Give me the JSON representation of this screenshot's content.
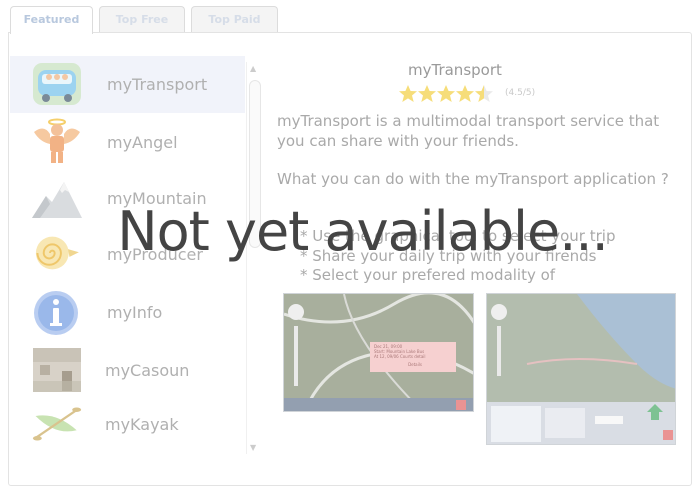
{
  "tabs": [
    {
      "label": "Featured",
      "active": true
    },
    {
      "label": "Top Free",
      "active": false
    },
    {
      "label": "Top Paid",
      "active": false
    }
  ],
  "apps": [
    {
      "name": "myTransport",
      "icon": "bus-icon",
      "selected": true
    },
    {
      "name": "myAngel",
      "icon": "angel-icon",
      "selected": false
    },
    {
      "name": "myMountain",
      "icon": "mountain-icon",
      "selected": false
    },
    {
      "name": "myProducer",
      "icon": "swirl-icon",
      "selected": false
    },
    {
      "name": "myInfo",
      "icon": "info-icon",
      "selected": false
    },
    {
      "name": "myCasoun",
      "icon": "house-icon",
      "selected": false
    },
    {
      "name": "myKayak",
      "icon": "kayak-icon",
      "selected": false
    }
  ],
  "detail": {
    "title": "myTransport",
    "stars": 4.5,
    "rating_text": "(4.5/5)",
    "description": "myTransport is a multimodal transport service that you can share with your friends.",
    "question": "What you can do with the myTransport application ?",
    "features": [
      "* Use the graphical tool to select your trip",
      "* Share your daily trip with your firends",
      "* Select your prefered modality of"
    ],
    "screenshot1_popup": [
      "Dec 21, 09:00",
      "Start: Mountain Lake Bus",
      "At 12, 09/06 Courts detail",
      "Details"
    ]
  },
  "overlay_text": "Not yet available...",
  "colors": {
    "tab_active": "#b8c8de",
    "star": "#f3d24d",
    "text": "#a9a9a9"
  }
}
